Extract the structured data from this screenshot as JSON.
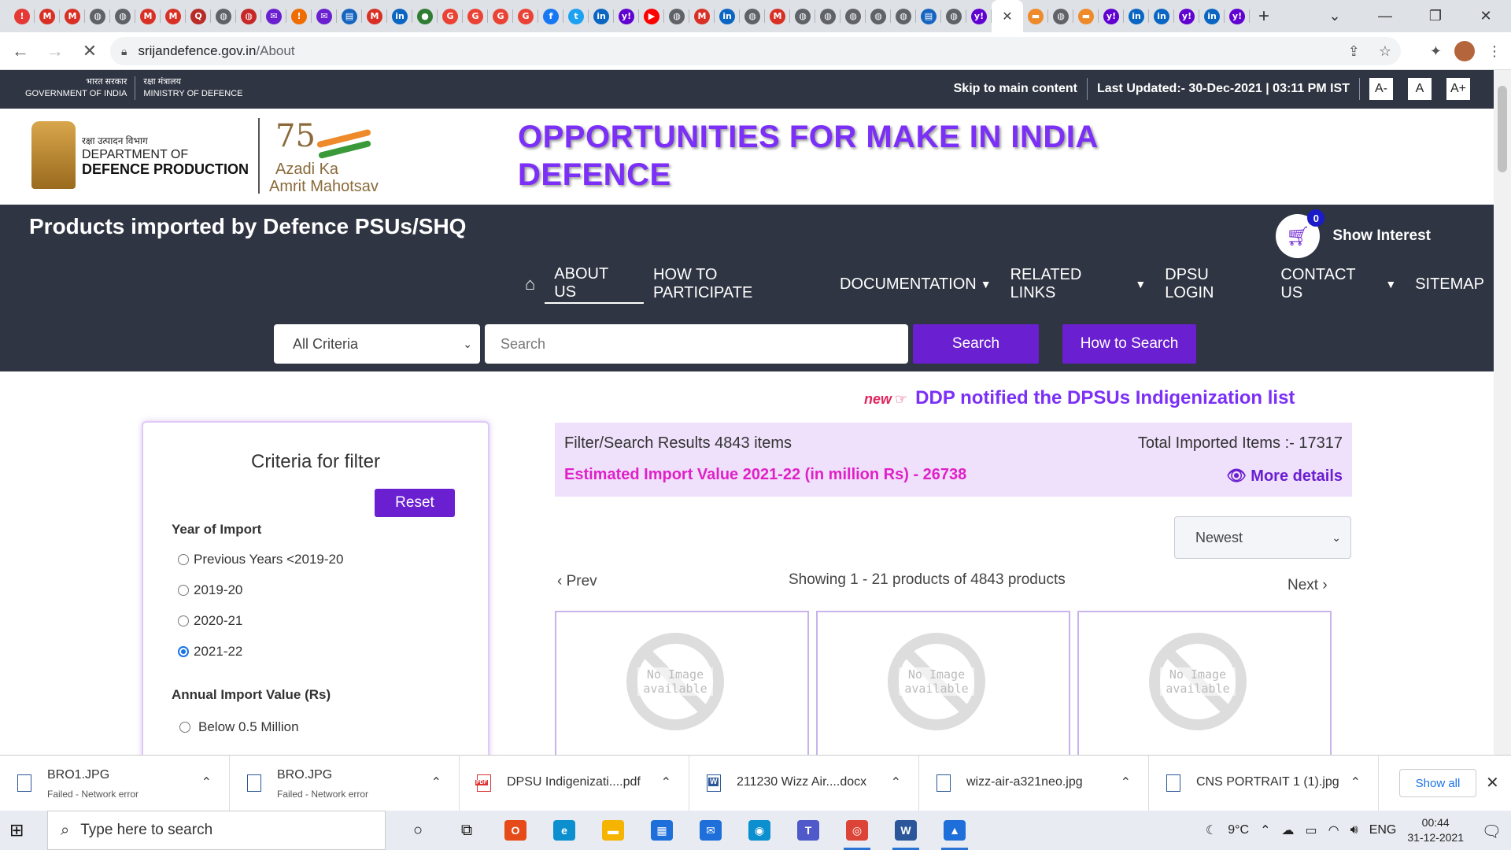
{
  "browser": {
    "tabs": [
      {
        "icon": "alert-icon",
        "glyph": "!",
        "color": "#e53935"
      },
      {
        "icon": "gmail-icon",
        "glyph": "M",
        "color": "#d93025"
      },
      {
        "icon": "gmail-icon",
        "glyph": "M",
        "color": "#d93025"
      },
      {
        "icon": "globe-icon",
        "glyph": "◍",
        "color": "#5f6368"
      },
      {
        "icon": "globe-icon",
        "glyph": "◍",
        "color": "#5f6368"
      },
      {
        "icon": "gmail-icon",
        "glyph": "M",
        "color": "#d93025"
      },
      {
        "icon": "gmail-icon",
        "glyph": "M",
        "color": "#d93025"
      },
      {
        "icon": "quora-icon",
        "glyph": "Q",
        "color": "#b92b27"
      },
      {
        "icon": "globe-icon",
        "glyph": "◍",
        "color": "#5f6368"
      },
      {
        "icon": "globe-icon",
        "glyph": "◍",
        "color": "#c62828"
      },
      {
        "icon": "mail-icon",
        "glyph": "✉",
        "color": "#6a1fd0"
      },
      {
        "icon": "alert-icon",
        "glyph": "!",
        "color": "#ef6c00"
      },
      {
        "icon": "mail-icon",
        "glyph": "✉",
        "color": "#6a1fd0"
      },
      {
        "icon": "page-icon",
        "glyph": "▤",
        "color": "#1565c0"
      },
      {
        "icon": "gmail-icon",
        "glyph": "M",
        "color": "#d93025"
      },
      {
        "icon": "linkedin-icon",
        "glyph": "in",
        "color": "#0a66c2"
      },
      {
        "icon": "chat-icon",
        "glyph": "●",
        "color": "#2e7d32"
      },
      {
        "icon": "google-icon",
        "glyph": "G",
        "color": "#ea4335"
      },
      {
        "icon": "google-icon",
        "glyph": "G",
        "color": "#ea4335"
      },
      {
        "icon": "google-icon",
        "glyph": "G",
        "color": "#ea4335"
      },
      {
        "icon": "google-icon",
        "glyph": "G",
        "color": "#ea4335"
      },
      {
        "icon": "facebook-icon",
        "glyph": "f",
        "color": "#1877f2"
      },
      {
        "icon": "twitter-icon",
        "glyph": "t",
        "color": "#1da1f2"
      },
      {
        "icon": "linkedin-icon",
        "glyph": "in",
        "color": "#0a66c2"
      },
      {
        "icon": "yahoo-icon",
        "glyph": "y!",
        "color": "#6001d2"
      },
      {
        "icon": "youtube-icon",
        "glyph": "▶",
        "color": "#ff0000"
      },
      {
        "icon": "globe-icon",
        "glyph": "◍",
        "color": "#5f6368"
      },
      {
        "icon": "gmail-icon",
        "glyph": "M",
        "color": "#d93025"
      },
      {
        "icon": "linkedin-icon",
        "glyph": "in",
        "color": "#0a66c2"
      },
      {
        "icon": "globe-icon",
        "glyph": "◍",
        "color": "#5f6368"
      },
      {
        "icon": "gmail-icon",
        "glyph": "M",
        "color": "#d93025"
      },
      {
        "icon": "globe-icon",
        "glyph": "◍",
        "color": "#5f6368"
      },
      {
        "icon": "globe-icon",
        "glyph": "◍",
        "color": "#5f6368"
      },
      {
        "icon": "globe-icon",
        "glyph": "◍",
        "color": "#5f6368"
      },
      {
        "icon": "globe-icon",
        "glyph": "◍",
        "color": "#5f6368"
      },
      {
        "icon": "globe-icon",
        "glyph": "◍",
        "color": "#5f6368"
      },
      {
        "icon": "page-icon",
        "glyph": "▤",
        "color": "#1565c0"
      },
      {
        "icon": "globe-icon",
        "glyph": "◍",
        "color": "#5f6368"
      },
      {
        "icon": "yahoo-icon",
        "glyph": "y!",
        "color": "#6001d2"
      },
      {
        "icon": "close-icon",
        "glyph": "✕",
        "color": "#ffffff",
        "active": true
      },
      {
        "icon": "india-flag-icon",
        "glyph": "▬",
        "color": "#ef8a2a"
      },
      {
        "icon": "globe-icon",
        "glyph": "◍",
        "color": "#5f6368"
      },
      {
        "icon": "india-flag-icon",
        "glyph": "▬",
        "color": "#ef8a2a"
      },
      {
        "icon": "yahoo-icon",
        "glyph": "y!",
        "color": "#6001d2"
      },
      {
        "icon": "linkedin-icon",
        "glyph": "in",
        "color": "#0a66c2"
      },
      {
        "icon": "linkedin-icon",
        "glyph": "in",
        "color": "#0a66c2"
      },
      {
        "icon": "yahoo-icon",
        "glyph": "y!",
        "color": "#6001d2"
      },
      {
        "icon": "linkedin-icon",
        "glyph": "in",
        "color": "#0a66c2"
      },
      {
        "icon": "yahoo-icon",
        "glyph": "y!",
        "color": "#6001d2"
      }
    ],
    "url_host": "srijandefence.gov.in",
    "url_path": "/About"
  },
  "govbar": {
    "gov_hindi": "भारत सरकार",
    "gov_english": "GOVERNMENT OF INDIA",
    "mod_hindi": "रक्षा मंत्रालय",
    "mod_english": "MINISTRY OF DEFENCE",
    "skip_link": "Skip to main content",
    "last_updated": "Last Updated:- 30-Dec-2021 | 03:11 PM IST",
    "font_decrease": "A-",
    "font_normal": "A",
    "font_increase": "A+"
  },
  "header": {
    "ddp_hindi": "रक्षा उत्पादन विभाग",
    "ddp_line1": "DEPARTMENT OF",
    "ddp_line2": "DEFENCE PRODUCTION",
    "azadi_75": "75",
    "azadi_line1": "Azadi Ka",
    "azadi_line2": "Amrit Mahotsav",
    "headline_line1": "OPPORTUNITIES FOR MAKE IN INDIA",
    "headline_line2": "DEFENCE"
  },
  "band": {
    "title": "Products imported by Defence PSUs/SHQ",
    "cart_count": "0",
    "show_interest": "Show Interest",
    "nav": [
      {
        "label": "ABOUT US",
        "active": true
      },
      {
        "label": "HOW TO PARTICIPATE"
      },
      {
        "label": "DOCUMENTATION",
        "dropdown": true
      },
      {
        "label": "RELATED LINKS",
        "dropdown": true
      },
      {
        "label": "DPSU LOGIN"
      },
      {
        "label": "CONTACT US",
        "dropdown": true
      },
      {
        "label": "SITEMAP"
      }
    ],
    "criteria_selected": "All Criteria",
    "search_placeholder": "Search",
    "search_button": "Search",
    "how_to_search": "How to Search"
  },
  "notice": {
    "new_label": "new",
    "text": "DDP notified the DPSUs Indigenization list"
  },
  "filter": {
    "title": "Criteria for filter",
    "reset": "Reset",
    "year_title": "Year of Import",
    "years": [
      {
        "label": "Previous Years <2019-20",
        "checked": false
      },
      {
        "label": "2019-20",
        "checked": false
      },
      {
        "label": "2020-21",
        "checked": false
      },
      {
        "label": "2021-22",
        "checked": true
      }
    ],
    "value_title": "Annual Import Value (Rs)",
    "values": [
      {
        "label": "Below 0.5 Million",
        "checked": false
      }
    ]
  },
  "results": {
    "filter_count": "Filter/Search Results 4843 items",
    "total_imported": "Total Imported Items :- 17317",
    "estimated_value": "Estimated Import Value  2021-22 (in million Rs) - 26738",
    "more_details": "More details",
    "sort_selected": "Newest",
    "prev": "Prev",
    "next": "Next",
    "showing": "Showing 1 - 21 products of 4843 products",
    "cards": [
      {
        "placeholder": "No Image available"
      },
      {
        "placeholder": "No Image available"
      },
      {
        "placeholder": "No Image available"
      }
    ]
  },
  "downloads": {
    "items": [
      {
        "name": "BRO1.JPG",
        "status": "Failed - Network error",
        "type": "img"
      },
      {
        "name": "BRO.JPG",
        "status": "Failed - Network error",
        "type": "img"
      },
      {
        "name": "DPSU Indigenizati....pdf",
        "status": "",
        "type": "pdf"
      },
      {
        "name": "211230 Wizz Air....docx",
        "status": "",
        "type": "doc"
      },
      {
        "name": "wizz-air-a321neo.jpg",
        "status": "",
        "type": "img"
      },
      {
        "name": "CNS PORTRAIT 1 (1).jpg",
        "status": "",
        "type": "img"
      }
    ],
    "show_all": "Show all"
  },
  "taskbar": {
    "search_placeholder": "Type here to search",
    "apps": [
      {
        "icon": "cortana-icon",
        "glyph": "○",
        "color": "transparent",
        "fg": "#111"
      },
      {
        "icon": "task-view-icon",
        "glyph": "⧉",
        "color": "transparent",
        "fg": "#111"
      },
      {
        "icon": "office-icon",
        "glyph": "O",
        "color": "#e64a19"
      },
      {
        "icon": "edge-icon",
        "glyph": "e",
        "color": "#0b8fcf"
      },
      {
        "icon": "file-explorer-icon",
        "glyph": "▬",
        "color": "#f4b400"
      },
      {
        "icon": "store-icon",
        "glyph": "▦",
        "color": "#1e6fd9"
      },
      {
        "icon": "mail-icon",
        "glyph": "✉",
        "color": "#1e6fd9"
      },
      {
        "icon": "vpn-icon",
        "glyph": "◉",
        "color": "#0b8fcf"
      },
      {
        "icon": "teams-icon",
        "glyph": "T",
        "color": "#5059c9"
      },
      {
        "icon": "chrome-icon",
        "glyph": "◎",
        "color": "#db4437",
        "running": true
      },
      {
        "icon": "word-icon",
        "glyph": "W",
        "color": "#2b579a",
        "running": true
      },
      {
        "icon": "photos-icon",
        "glyph": "▲",
        "color": "#1e6fd9",
        "running": true
      }
    ],
    "temperature": "9°C",
    "language": "ENG",
    "time": "00:44",
    "date": "31-12-2021"
  }
}
